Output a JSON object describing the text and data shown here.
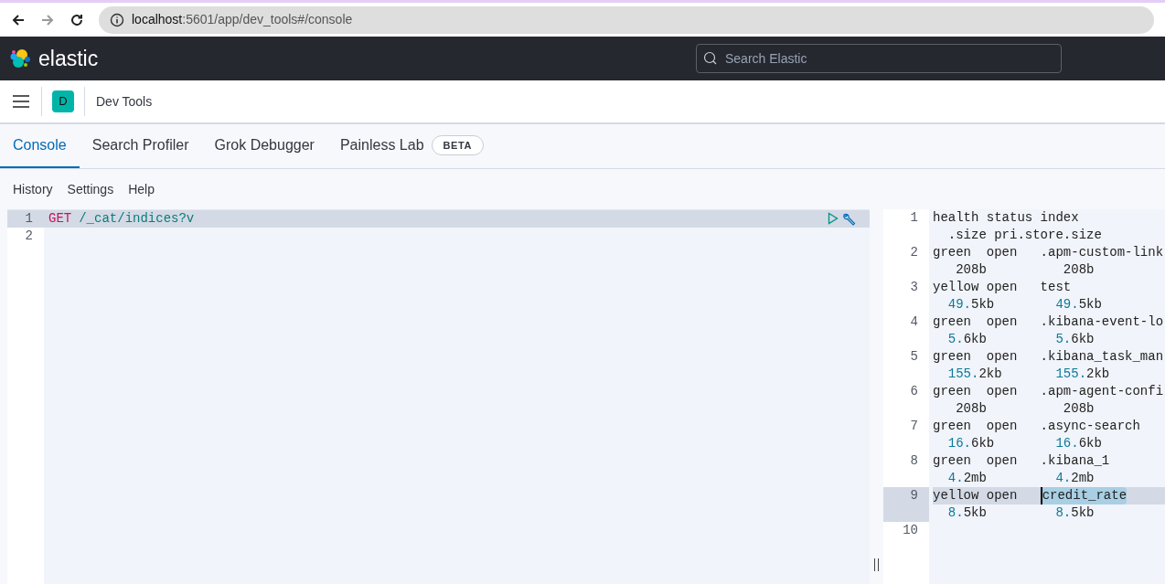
{
  "browser": {
    "url_host": "localhost",
    "url_path": ":5601/app/dev_tools#/console"
  },
  "header": {
    "brand": "elastic",
    "search": {
      "placeholder": "Search Elastic"
    }
  },
  "breadcrumb": {
    "avatar": "D",
    "title": "Dev Tools"
  },
  "tabs": [
    {
      "label": "Console",
      "selected": true
    },
    {
      "label": "Search Profiler",
      "selected": false
    },
    {
      "label": "Grok Debugger",
      "selected": false
    },
    {
      "label": "Painless Lab",
      "selected": false,
      "badge": "BETA"
    }
  ],
  "menu": [
    "History",
    "Settings",
    "Help"
  ],
  "request": [
    {
      "number": "1",
      "method": "GET",
      "path": "/_cat/indices?v",
      "active": true
    },
    {
      "number": "2",
      "active": false
    }
  ],
  "response": [
    {
      "number": "1",
      "text": "health status index",
      "wrap": "  .size pri.store.size",
      "active": false
    },
    {
      "number": "2",
      "text": "green  open   .apm-custom-link",
      "wrap": "   208b          208b",
      "active": false
    },
    {
      "number": "3",
      "text": "yellow open   test",
      "wrap": "  49.5kb        49.5kb",
      "active": false
    },
    {
      "number": "4",
      "text": "green  open   .kibana-event-lo",
      "wrap": "  5.6kb         5.6kb",
      "active": false
    },
    {
      "number": "5",
      "text": "green  open   .kibana_task_man",
      "wrap": "  155.2kb       155.2kb",
      "active": false
    },
    {
      "number": "6",
      "text": "green  open   .apm-agent-confi",
      "wrap": "   208b          208b",
      "active": false
    },
    {
      "number": "7",
      "text": "green  open   .async-search",
      "wrap": "  16.6kb        16.6kb",
      "active": false
    },
    {
      "number": "8",
      "text": "green  open   .kibana_1",
      "wrap": "  4.2mb         4.2mb",
      "active": false
    },
    {
      "number": "9",
      "text": "yellow open   ",
      "selection": "credit_rate",
      "wrap": "  8.5kb         8.5kb",
      "active": true
    },
    {
      "number": "10",
      "active": false
    }
  ]
}
